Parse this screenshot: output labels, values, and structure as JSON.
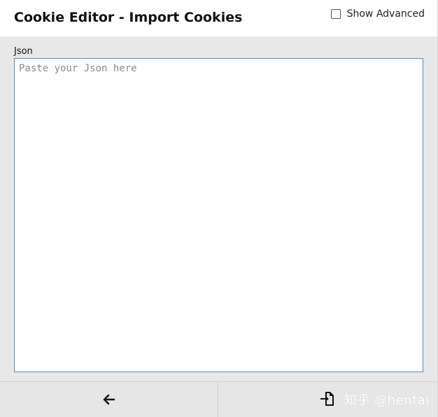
{
  "header": {
    "title": "Cookie Editor - Import Cookies",
    "show_advanced_label": "Show Advanced",
    "show_advanced_checked": false
  },
  "form": {
    "json_label": "Json",
    "json_placeholder": "Paste your Json here",
    "json_value": ""
  },
  "footer": {
    "back_icon": "arrow-left-icon",
    "import_icon": "file-import-icon",
    "watermark": "知乎 @hentai"
  },
  "colors": {
    "header_bg": "#ffffff",
    "body_bg": "#e8e8e8",
    "textarea_border": "#5b87b8",
    "footer_bg": "#e6e6e6"
  }
}
